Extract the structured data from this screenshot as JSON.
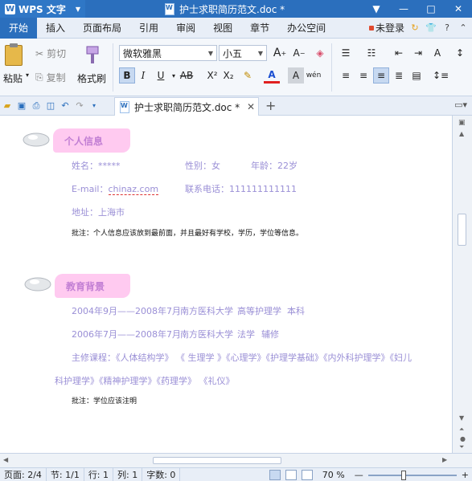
{
  "titlebar": {
    "app_name": "WPS 文字",
    "doc_title": "护士求职简历范文.doc *",
    "controls": [
      "▼",
      "—",
      "□",
      "✕"
    ]
  },
  "menubar": {
    "items": [
      "开始",
      "插入",
      "页面布局",
      "引用",
      "审阅",
      "视图",
      "章节",
      "办公空间"
    ],
    "active": "开始",
    "login": "未登录"
  },
  "ribbon": {
    "paste": "粘贴",
    "cut": "剪切",
    "copy": "复制",
    "format_painter": "格式刷",
    "font_name": "微软雅黑",
    "font_size": "小五",
    "bold": "B",
    "italic": "I",
    "underline": "U",
    "strike": "AB",
    "superscript": "X²",
    "subscript": "X₂",
    "font_color": "A",
    "char_shade": "A",
    "phonetic": "wén",
    "grow": "A⁺",
    "shrink": "A⁻"
  },
  "tabbar": {
    "doc_tab": "护士求职简历范文.doc *",
    "add": "+"
  },
  "document": {
    "section1": {
      "heading": "个人信息",
      "name_label": "姓名：*****",
      "gender": "性别：女",
      "age": "年龄：22岁",
      "email_prefix": "E-mail：",
      "email_value": "chinaz.com",
      "phone": "联系电话：111111111111",
      "address": "地址：上海市",
      "note": "批注：个人信息应该放到最前面，并且最好有学校，学历，学位等信息。"
    },
    "section2": {
      "heading": "教育背景",
      "edu1_date": "2004年9月——2008年7月",
      "edu1_school": "南方医科大学",
      "edu1_major": "高等护理学",
      "edu1_degree": "本科",
      "edu2_date": "2006年7月——2008年7月",
      "edu2_school": "南方医科大学",
      "edu2_major": "法学",
      "edu2_degree": "辅修",
      "courses_line1": "主修课程：《人体结构学》 《 生理学 》《心理学》《护理学基础》《内外科护理学》《妇儿",
      "courses_line2": "科护理学》《精神护理学》《药理学》 《礼仪》",
      "note": "批注：学位应该注明"
    }
  },
  "statusbar": {
    "page": "页面: 2/4",
    "section": "节: 1/1",
    "row": "行: 1",
    "col": "列: 1",
    "words": "字数: 0",
    "zoom": "70 %",
    "zoom_level": 0.4
  },
  "colors": {
    "accent": "#2b6fbd",
    "banner_bg": "#ffcaf0",
    "banner_text": "#c27fd4",
    "body_text": "#9a8fd6"
  }
}
